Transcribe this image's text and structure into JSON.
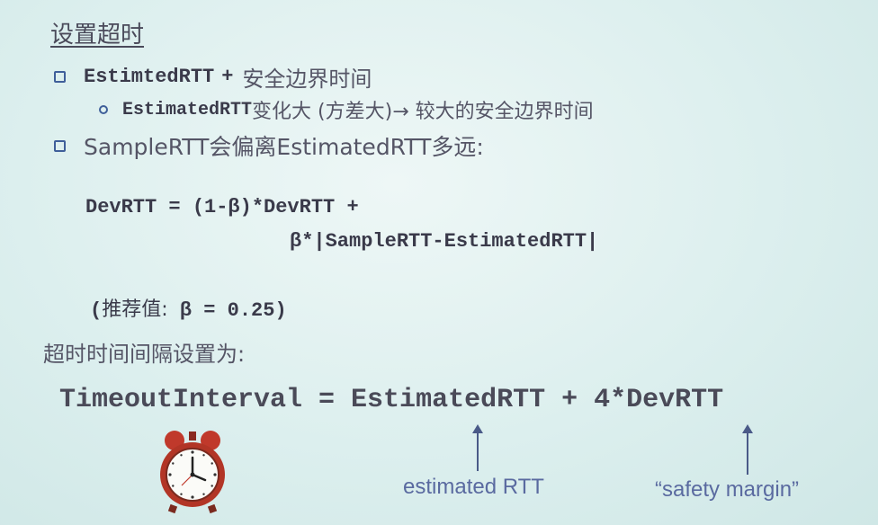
{
  "title": "设置超时",
  "bullet1": {
    "code": "EstimtedRTT",
    "plus": "+",
    "text": "安全边界时间"
  },
  "sub1": {
    "code": "EstimatedRTT",
    "text": "变化大 (方差大)→ 较大的安全边界时间"
  },
  "bullet2": {
    "text": "SampleRTT会偏离EstimatedRTT多远:"
  },
  "formula": {
    "line1": "DevRTT = (1-β)*DevRTT +",
    "line2": "β*|SampleRTT-EstimatedRTT|"
  },
  "recommend": {
    "open": "(",
    "cn": "推荐值:",
    "value": " β = 0.25)"
  },
  "timeout_label": "超时时间间隔设置为:",
  "timeout_formula": "TimeoutInterval = EstimatedRTT + 4*DevRTT",
  "annotations": {
    "estimated": "estimated RTT",
    "safety": "“safety margin”"
  },
  "colors": {
    "bullet": "#3f5f9a",
    "annotation": "#5a6aa0",
    "clock_red": "#c0392b"
  }
}
